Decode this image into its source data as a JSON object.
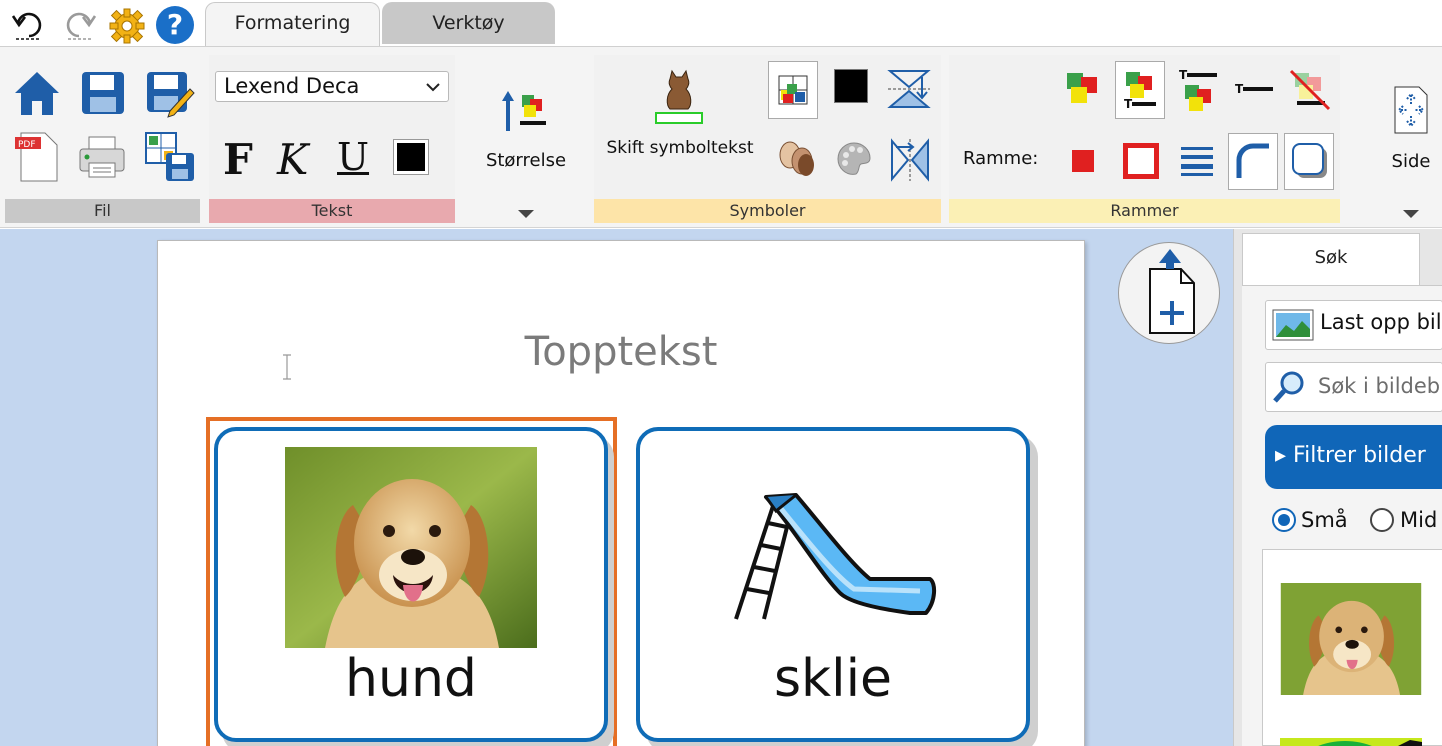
{
  "quick_toolbar": {
    "undo_icon": "undo-icon",
    "redo_icon": "redo-icon",
    "settings_icon": "gear-icon",
    "help_icon": "help-icon",
    "help_glyph": "?"
  },
  "tabs": [
    {
      "label": "Formatering",
      "active": true
    },
    {
      "label": "Verktøy",
      "active": false
    }
  ],
  "groups": {
    "fil": {
      "label": "Fil"
    },
    "tekst": {
      "label": "Tekst",
      "font_name": "Lexend Deca",
      "bold": "F",
      "italic": "K",
      "underline": "U"
    },
    "size": {
      "label": "Størrelse"
    },
    "symboler": {
      "label": "Symboler",
      "switch_label": "Skift symboltekst"
    },
    "rammer": {
      "label": "Rammer",
      "frame_label": "Ramme:"
    },
    "side": {
      "label": "Side"
    }
  },
  "colors": {
    "fil_label_bg": "#c8c8c8",
    "tekst_label_bg": "#e8a9ae",
    "symboler_label_bg": "#fde4a8",
    "rammer_label_bg": "#fbf0b5",
    "card_border": "#0f6cb7",
    "selection_border": "#e56f25",
    "workspace_bg": "#c3d6ef",
    "filter_button_bg": "#1066b8"
  },
  "page": {
    "header_text": "Topptekst",
    "cards": [
      {
        "label": "hund",
        "image": "dog-photo",
        "selected": true
      },
      {
        "label": "sklie",
        "image": "slide-symbol",
        "selected": false
      }
    ]
  },
  "panel": {
    "tab": "Søk",
    "upload_label": "Last opp bild",
    "search_placeholder": "Søk i bildeb",
    "filter_label": "▸ Filtrer bilder",
    "size_options": [
      {
        "label": "Små",
        "checked": true
      },
      {
        "label": "Mid",
        "checked": false
      }
    ]
  }
}
